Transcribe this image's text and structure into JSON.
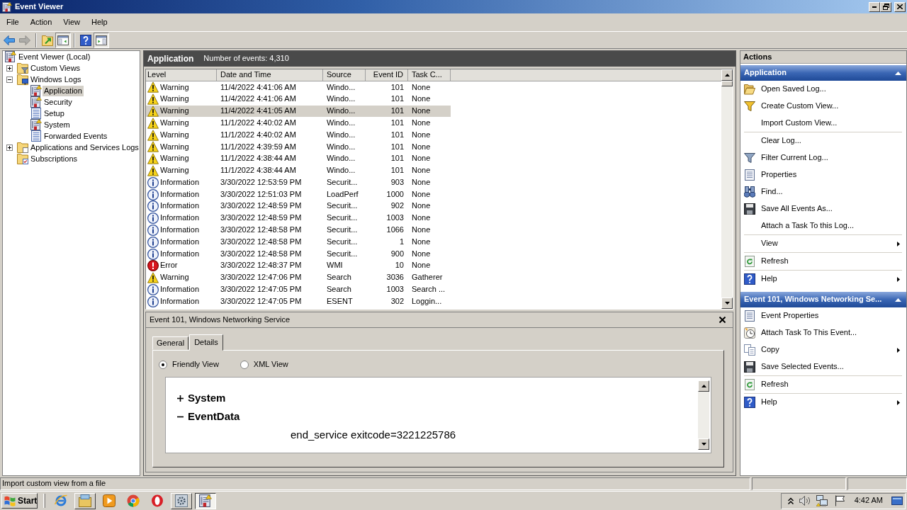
{
  "window": {
    "title": "Event Viewer"
  },
  "menu": [
    {
      "label": "File"
    },
    {
      "label": "Action"
    },
    {
      "label": "View"
    },
    {
      "label": "Help"
    }
  ],
  "toolbar": [
    [
      {
        "kind": "back",
        "disabled": false,
        "pressed": false
      },
      {
        "kind": "forward",
        "disabled": true,
        "pressed": false
      }
    ],
    [
      {
        "kind": "up",
        "disabled": false,
        "pressed": false
      },
      {
        "kind": "console-tree",
        "disabled": false,
        "pressed": true
      }
    ],
    [
      {
        "kind": "help",
        "disabled": false,
        "pressed": false
      },
      {
        "kind": "action-pane",
        "disabled": false,
        "pressed": true
      }
    ]
  ],
  "tree": [
    {
      "label": "Event Viewer (Local)",
      "kind": "root",
      "selected": false,
      "children": [
        {
          "label": "Custom Views",
          "kind": "folder-filter",
          "expanded": false,
          "selected": false
        },
        {
          "label": "Windows Logs",
          "kind": "folder-computer",
          "expanded": true,
          "selected": false,
          "children": [
            {
              "label": "Application",
              "kind": "log",
              "selected": true
            },
            {
              "label": "Security",
              "kind": "log",
              "selected": false
            },
            {
              "label": "Setup",
              "kind": "log-plain",
              "selected": false
            },
            {
              "label": "System",
              "kind": "log",
              "selected": false
            },
            {
              "label": "Forwarded Events",
              "kind": "log-plain",
              "selected": false
            }
          ]
        },
        {
          "label": "Applications and Services Logs",
          "kind": "folder-doc",
          "expanded": false,
          "selected": false
        },
        {
          "label": "Subscriptions",
          "kind": "subscriptions",
          "selected": false
        }
      ]
    }
  ],
  "log_view": {
    "title": "Application",
    "count": "Number of events: 4,310"
  },
  "events": {
    "columns": [
      "Level",
      "Date and Time",
      "Source",
      "Event ID",
      "Task C..."
    ],
    "rows": [
      {
        "kind": "warning",
        "selected": false,
        "cells": [
          "Warning",
          "11/4/2022 4:41:06 AM",
          "Windo...",
          "101",
          "None"
        ]
      },
      {
        "kind": "warning",
        "selected": false,
        "cells": [
          "Warning",
          "11/4/2022 4:41:06 AM",
          "Windo...",
          "101",
          "None"
        ]
      },
      {
        "kind": "warning",
        "selected": true,
        "cells": [
          "Warning",
          "11/4/2022 4:41:05 AM",
          "Windo...",
          "101",
          "None"
        ]
      },
      {
        "kind": "warning",
        "selected": false,
        "cells": [
          "Warning",
          "11/1/2022 4:40:02 AM",
          "Windo...",
          "101",
          "None"
        ]
      },
      {
        "kind": "warning",
        "selected": false,
        "cells": [
          "Warning",
          "11/1/2022 4:40:02 AM",
          "Windo...",
          "101",
          "None"
        ]
      },
      {
        "kind": "warning",
        "selected": false,
        "cells": [
          "Warning",
          "11/1/2022 4:39:59 AM",
          "Windo...",
          "101",
          "None"
        ]
      },
      {
        "kind": "warning",
        "selected": false,
        "cells": [
          "Warning",
          "11/1/2022 4:38:44 AM",
          "Windo...",
          "101",
          "None"
        ]
      },
      {
        "kind": "warning",
        "selected": false,
        "cells": [
          "Warning",
          "11/1/2022 4:38:44 AM",
          "Windo...",
          "101",
          "None"
        ]
      },
      {
        "kind": "information",
        "selected": false,
        "cells": [
          "Information",
          "3/30/2022 12:53:59 PM",
          "Securit...",
          "903",
          "None"
        ]
      },
      {
        "kind": "information",
        "selected": false,
        "cells": [
          "Information",
          "3/30/2022 12:51:03 PM",
          "LoadPerf",
          "1000",
          "None"
        ]
      },
      {
        "kind": "information",
        "selected": false,
        "cells": [
          "Information",
          "3/30/2022 12:48:59 PM",
          "Securit...",
          "902",
          "None"
        ]
      },
      {
        "kind": "information",
        "selected": false,
        "cells": [
          "Information",
          "3/30/2022 12:48:59 PM",
          "Securit...",
          "1003",
          "None"
        ]
      },
      {
        "kind": "information",
        "selected": false,
        "cells": [
          "Information",
          "3/30/2022 12:48:58 PM",
          "Securit...",
          "1066",
          "None"
        ]
      },
      {
        "kind": "information",
        "selected": false,
        "cells": [
          "Information",
          "3/30/2022 12:48:58 PM",
          "Securit...",
          "1",
          "None"
        ]
      },
      {
        "kind": "information",
        "selected": false,
        "cells": [
          "Information",
          "3/30/2022 12:48:58 PM",
          "Securit...",
          "900",
          "None"
        ]
      },
      {
        "kind": "error",
        "selected": false,
        "cells": [
          "Error",
          "3/30/2022 12:48:37 PM",
          "WMI",
          "10",
          "None"
        ]
      },
      {
        "kind": "warning",
        "selected": false,
        "cells": [
          "Warning",
          "3/30/2022 12:47:06 PM",
          "Search",
          "3036",
          "Gatherer"
        ]
      },
      {
        "kind": "information",
        "selected": false,
        "cells": [
          "Information",
          "3/30/2022 12:47:05 PM",
          "Search",
          "1003",
          "Search ..."
        ]
      },
      {
        "kind": "information",
        "selected": false,
        "cells": [
          "Information",
          "3/30/2022 12:47:05 PM",
          "ESENT",
          "302",
          "Loggin..."
        ]
      }
    ]
  },
  "detail": {
    "title": "Event 101, Windows Networking Service",
    "tabs": [
      {
        "label": "General",
        "selected": false
      },
      {
        "label": "Details",
        "selected": true
      }
    ],
    "views": [
      {
        "label": "Friendly View",
        "selected": true
      },
      {
        "label": "XML View",
        "selected": false
      }
    ],
    "content": [
      {
        "label": "System",
        "expanded": false
      },
      {
        "label": "EventData",
        "expanded": true,
        "children": [
          {
            "label": "end_service exitcode=3221225786"
          }
        ]
      }
    ]
  },
  "actions": {
    "title": "Actions",
    "sections": [
      {
        "title": "Application",
        "expanded": true,
        "groups": [
          [
            {
              "label": "Open Saved Log...",
              "kind": "open",
              "submenu": false
            },
            {
              "label": "Create Custom View...",
              "kind": "create",
              "submenu": false
            },
            {
              "label": "Import Custom View...",
              "kind": "import",
              "submenu": false
            }
          ],
          [
            {
              "label": "Clear Log...",
              "kind": "clear",
              "submenu": false
            },
            {
              "label": "Filter Current Log...",
              "kind": "filter",
              "submenu": false
            },
            {
              "label": "Properties",
              "kind": "properties",
              "submenu": false
            },
            {
              "label": "Find...",
              "kind": "find",
              "submenu": false
            },
            {
              "label": "Save All Events As...",
              "kind": "save",
              "submenu": false
            },
            {
              "label": "Attach a Task To this Log...",
              "kind": "attach",
              "submenu": false
            }
          ],
          [
            {
              "label": "View",
              "kind": "view",
              "submenu": true
            }
          ],
          [
            {
              "label": "Refresh",
              "kind": "refresh",
              "submenu": false
            }
          ],
          [
            {
              "label": "Help",
              "kind": "help",
              "submenu": true
            }
          ]
        ]
      },
      {
        "title": "Event 101, Windows Networking Se...",
        "expanded": true,
        "groups": [
          [
            {
              "label": "Event Properties",
              "kind": "properties",
              "submenu": false
            },
            {
              "label": "Attach Task To This Event...",
              "kind": "attach-task",
              "submenu": false
            },
            {
              "label": "Copy",
              "kind": "copy",
              "submenu": true
            },
            {
              "label": "Save Selected Events...",
              "kind": "save",
              "submenu": false
            }
          ],
          [
            {
              "label": "Refresh",
              "kind": "refresh",
              "submenu": false
            }
          ],
          [
            {
              "label": "Help",
              "kind": "help",
              "submenu": true
            }
          ]
        ]
      }
    ]
  },
  "status_bar": {
    "text": "Import custom view from a file"
  },
  "taskbar": {
    "start": "Start",
    "apps": [
      {
        "kind": "browser-e",
        "open": false,
        "active": false
      },
      {
        "kind": "folder",
        "open": true,
        "active": false
      },
      {
        "kind": "player",
        "open": false,
        "active": false
      },
      {
        "kind": "browser-ring",
        "open": false,
        "active": false
      },
      {
        "kind": "browser-o",
        "open": false,
        "active": false
      },
      {
        "kind": "tool",
        "open": true,
        "active": false
      },
      {
        "kind": "event-log",
        "open": true,
        "active": true
      }
    ],
    "clock": "4:42 AM"
  }
}
